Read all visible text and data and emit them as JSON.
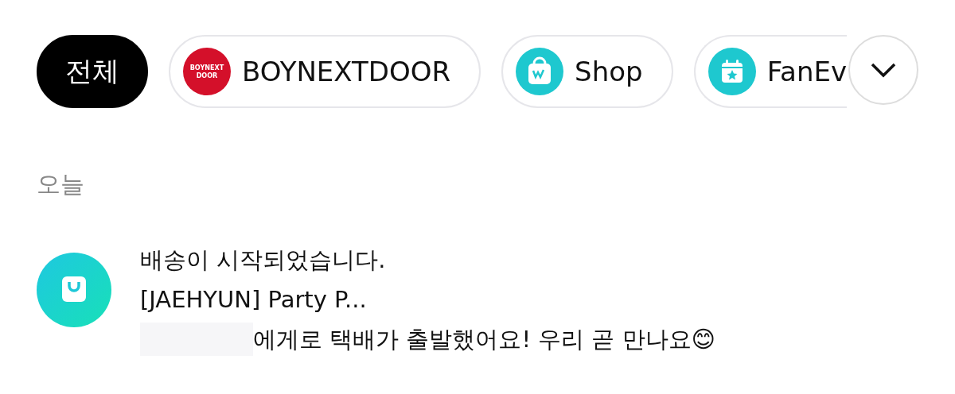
{
  "filters": [
    {
      "label": "전체",
      "selected": true,
      "kind": "text"
    },
    {
      "label": "BOYNEXTDOOR",
      "selected": false,
      "kind": "artist",
      "logo_text": [
        "BOYNEXT",
        "DOOR"
      ]
    },
    {
      "label": "Shop",
      "selected": false,
      "kind": "shop"
    },
    {
      "label": "FanEv",
      "selected": false,
      "kind": "event"
    }
  ],
  "section_title": "오늘",
  "notifications": [
    {
      "kind": "shop",
      "title": "배송이 시작되었습니다.",
      "subtitle": "[JAEHYUN] Party P...",
      "redacted": true,
      "body": "에게로 택배가 출발했어요! 우리 곧 만나요😊"
    }
  ]
}
